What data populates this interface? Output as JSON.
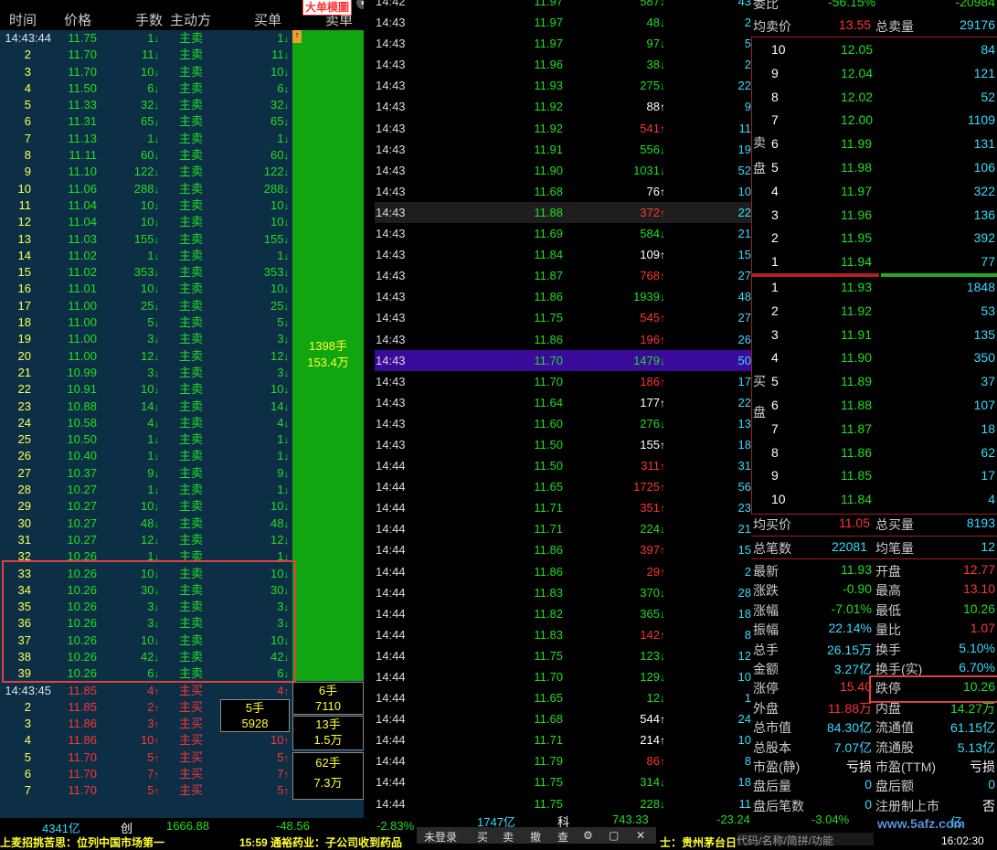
{
  "left": {
    "headers": [
      "时间",
      "价格",
      "手数",
      "主动方",
      "买单",
      "卖单"
    ],
    "badge": "大单模圖",
    "rows": [
      {
        "t": "14:43:44",
        "p": "11.75",
        "v": "1",
        "s": "主卖",
        "b": "1"
      },
      {
        "t": "2",
        "p": "11.70",
        "v": "11",
        "s": "主卖",
        "b": "11"
      },
      {
        "t": "3",
        "p": "11.70",
        "v": "10",
        "s": "主卖",
        "b": "10"
      },
      {
        "t": "4",
        "p": "11.50",
        "v": "6",
        "s": "主卖",
        "b": "6"
      },
      {
        "t": "5",
        "p": "11.33",
        "v": "32",
        "s": "主卖",
        "b": "32"
      },
      {
        "t": "6",
        "p": "11.31",
        "v": "65",
        "s": "主卖",
        "b": "65"
      },
      {
        "t": "7",
        "p": "11.13",
        "v": "1",
        "s": "主卖",
        "b": "1"
      },
      {
        "t": "8",
        "p": "11.11",
        "v": "60",
        "s": "主卖",
        "b": "60"
      },
      {
        "t": "9",
        "p": "11.10",
        "v": "122",
        "s": "主卖",
        "b": "122"
      },
      {
        "t": "10",
        "p": "11.06",
        "v": "288",
        "s": "主卖",
        "b": "288"
      },
      {
        "t": "11",
        "p": "11.04",
        "v": "10",
        "s": "主卖",
        "b": "10"
      },
      {
        "t": "12",
        "p": "11.04",
        "v": "10",
        "s": "主卖",
        "b": "10"
      },
      {
        "t": "13",
        "p": "11.03",
        "v": "155",
        "s": "主卖",
        "b": "155"
      },
      {
        "t": "14",
        "p": "11.02",
        "v": "1",
        "s": "主卖",
        "b": "1"
      },
      {
        "t": "15",
        "p": "11.02",
        "v": "353",
        "s": "主卖",
        "b": "353"
      },
      {
        "t": "16",
        "p": "11.01",
        "v": "10",
        "s": "主卖",
        "b": "10"
      },
      {
        "t": "17",
        "p": "11.00",
        "v": "25",
        "s": "主卖",
        "b": "25"
      },
      {
        "t": "18",
        "p": "11.00",
        "v": "5",
        "s": "主卖",
        "b": "5"
      },
      {
        "t": "19",
        "p": "11.00",
        "v": "3",
        "s": "主卖",
        "b": "3"
      },
      {
        "t": "20",
        "p": "11.00",
        "v": "12",
        "s": "主卖",
        "b": "12"
      },
      {
        "t": "21",
        "p": "10.99",
        "v": "3",
        "s": "主卖",
        "b": "3"
      },
      {
        "t": "22",
        "p": "10.91",
        "v": "10",
        "s": "主卖",
        "b": "10"
      },
      {
        "t": "23",
        "p": "10.88",
        "v": "14",
        "s": "主卖",
        "b": "14"
      },
      {
        "t": "24",
        "p": "10.58",
        "v": "4",
        "s": "主卖",
        "b": "4"
      },
      {
        "t": "25",
        "p": "10.50",
        "v": "1",
        "s": "主卖",
        "b": "1"
      },
      {
        "t": "26",
        "p": "10.40",
        "v": "1",
        "s": "主卖",
        "b": "1"
      },
      {
        "t": "27",
        "p": "10.37",
        "v": "9",
        "s": "主卖",
        "b": "9"
      },
      {
        "t": "28",
        "p": "10.27",
        "v": "1",
        "s": "主卖",
        "b": "1"
      },
      {
        "t": "29",
        "p": "10.27",
        "v": "10",
        "s": "主卖",
        "b": "10"
      },
      {
        "t": "30",
        "p": "10.27",
        "v": "48",
        "s": "主卖",
        "b": "48"
      },
      {
        "t": "31",
        "p": "10.27",
        "v": "12",
        "s": "主卖",
        "b": "12"
      },
      {
        "t": "32",
        "p": "10.26",
        "v": "1",
        "s": "主卖",
        "b": "1"
      },
      {
        "t": "33",
        "p": "10.26",
        "v": "10",
        "s": "主卖",
        "b": "10"
      },
      {
        "t": "34",
        "p": "10.26",
        "v": "30",
        "s": "主卖",
        "b": "30"
      },
      {
        "t": "35",
        "p": "10.26",
        "v": "3",
        "s": "主卖",
        "b": "3"
      },
      {
        "t": "36",
        "p": "10.26",
        "v": "3",
        "s": "主卖",
        "b": "3"
      },
      {
        "t": "37",
        "p": "10.26",
        "v": "10",
        "s": "主卖",
        "b": "10"
      },
      {
        "t": "38",
        "p": "10.26",
        "v": "42",
        "s": "主卖",
        "b": "42"
      },
      {
        "t": "39",
        "p": "10.26",
        "v": "6",
        "s": "主卖",
        "b": "6"
      },
      {
        "t": "14:43:45",
        "p": "11.85",
        "v": "4",
        "s": "主买",
        "b": "4"
      },
      {
        "t": "2",
        "p": "11.85",
        "v": "2",
        "s": "主买",
        "b": "2"
      },
      {
        "t": "3",
        "p": "11.86",
        "v": "3",
        "s": "主买",
        "b": "3"
      },
      {
        "t": "4",
        "p": "11.86",
        "v": "10",
        "s": "主买",
        "b": "10"
      },
      {
        "t": "5",
        "p": "11.70",
        "v": "5",
        "s": "主买",
        "b": "5"
      },
      {
        "t": "6",
        "p": "11.70",
        "v": "7",
        "s": "主买",
        "b": "7"
      },
      {
        "t": "7",
        "p": "11.70",
        "v": "5",
        "s": "主买",
        "b": "5"
      }
    ],
    "big_buy": [
      "1398手",
      "153.4万"
    ],
    "order_boxes": [
      {
        "a": "6手",
        "b": "7110"
      },
      {
        "a": "5手",
        "b": "5928"
      },
      {
        "a": "13手",
        "b": "1.5万"
      },
      {
        "a": "62手",
        "b": "7.3万"
      }
    ]
  },
  "mid": {
    "rows": [
      {
        "t": "14:42",
        "p": "11.97",
        "v": "587",
        "d": "down",
        "n": "43"
      },
      {
        "t": "14:43",
        "p": "11.97",
        "v": "48",
        "d": "down",
        "n": "2"
      },
      {
        "t": "14:43",
        "p": "11.97",
        "v": "97",
        "d": "down",
        "n": "5"
      },
      {
        "t": "14:43",
        "p": "11.96",
        "v": "38",
        "d": "down",
        "n": "2"
      },
      {
        "t": "14:43",
        "p": "11.93",
        "v": "275",
        "d": "down",
        "n": "22"
      },
      {
        "t": "14:43",
        "p": "11.92",
        "v": "88",
        "d": "up-w",
        "n": "9"
      },
      {
        "t": "14:43",
        "p": "11.92",
        "v": "541",
        "d": "up",
        "n": "11"
      },
      {
        "t": "14:43",
        "p": "11.91",
        "v": "556",
        "d": "down",
        "n": "19"
      },
      {
        "t": "14:43",
        "p": "11.90",
        "v": "1031",
        "d": "down",
        "n": "52"
      },
      {
        "t": "14:43",
        "p": "11.68",
        "v": "76",
        "d": "up-w",
        "n": "10"
      },
      {
        "t": "14:43",
        "p": "11.88",
        "v": "372",
        "d": "up",
        "n": "22"
      },
      {
        "t": "14:43",
        "p": "11.69",
        "v": "584",
        "d": "down",
        "n": "21"
      },
      {
        "t": "14:43",
        "p": "11.84",
        "v": "109",
        "d": "up-w",
        "n": "15"
      },
      {
        "t": "14:43",
        "p": "11.87",
        "v": "768",
        "d": "up",
        "n": "27"
      },
      {
        "t": "14:43",
        "p": "11.86",
        "v": "1939",
        "d": "down",
        "n": "48"
      },
      {
        "t": "14:43",
        "p": "11.75",
        "v": "545",
        "d": "up",
        "n": "27"
      },
      {
        "t": "14:43",
        "p": "11.86",
        "v": "196",
        "d": "up",
        "n": "26"
      },
      {
        "t": "14:43",
        "p": "11.70",
        "v": "1479",
        "d": "down",
        "n": "50"
      },
      {
        "t": "14:43",
        "p": "11.70",
        "v": "186",
        "d": "up",
        "n": "17"
      },
      {
        "t": "14:43",
        "p": "11.64",
        "v": "177",
        "d": "up-w",
        "n": "22"
      },
      {
        "t": "14:43",
        "p": "11.60",
        "v": "276",
        "d": "down",
        "n": "13"
      },
      {
        "t": "14:43",
        "p": "11.50",
        "v": "155",
        "d": "up-w",
        "n": "18"
      },
      {
        "t": "14:44",
        "p": "11.50",
        "v": "311",
        "d": "up",
        "n": "31"
      },
      {
        "t": "14:44",
        "p": "11.65",
        "v": "1725",
        "d": "up",
        "n": "56"
      },
      {
        "t": "14:44",
        "p": "11.71",
        "v": "351",
        "d": "up",
        "n": "23"
      },
      {
        "t": "14:44",
        "p": "11.71",
        "v": "224",
        "d": "down",
        "n": "21"
      },
      {
        "t": "14:44",
        "p": "11.86",
        "v": "397",
        "d": "up",
        "n": "15"
      },
      {
        "t": "14:44",
        "p": "11.86",
        "v": "29",
        "d": "up",
        "n": "2"
      },
      {
        "t": "14:44",
        "p": "11.83",
        "v": "370",
        "d": "down",
        "n": "28"
      },
      {
        "t": "14:44",
        "p": "11.82",
        "v": "365",
        "d": "down",
        "n": "18"
      },
      {
        "t": "14:44",
        "p": "11.83",
        "v": "142",
        "d": "up",
        "n": "8"
      },
      {
        "t": "14:44",
        "p": "11.75",
        "v": "123",
        "d": "down",
        "n": "12"
      },
      {
        "t": "14:44",
        "p": "11.70",
        "v": "129",
        "d": "down",
        "n": "10"
      },
      {
        "t": "14:44",
        "p": "11.65",
        "v": "12",
        "d": "down",
        "n": "1"
      },
      {
        "t": "14:44",
        "p": "11.68",
        "v": "544",
        "d": "up-w",
        "n": "24"
      },
      {
        "t": "14:44",
        "p": "11.71",
        "v": "214",
        "d": "up-w",
        "n": "10"
      },
      {
        "t": "14:44",
        "p": "11.79",
        "v": "86",
        "d": "up",
        "n": "8"
      },
      {
        "t": "14:44",
        "p": "11.75",
        "v": "314",
        "d": "down",
        "n": "18"
      },
      {
        "t": "14:44",
        "p": "11.75",
        "v": "228",
        "d": "down",
        "n": "11"
      }
    ]
  },
  "right": {
    "top_ratio_label": "委比",
    "top_ratio_value": "-56.15%",
    "top_diff": "-20984",
    "avg_sell_label": "均卖价",
    "avg_sell_value": "13.55",
    "total_sell_label": "总卖量",
    "total_sell_value": "29176",
    "sell_side_label": "卖盘",
    "buy_side_label": "买盘",
    "sells": [
      {
        "n": "10",
        "p": "12.05",
        "v": "84"
      },
      {
        "n": "9",
        "p": "12.04",
        "v": "121"
      },
      {
        "n": "8",
        "p": "12.02",
        "v": "52"
      },
      {
        "n": "7",
        "p": "12.00",
        "v": "1109"
      },
      {
        "n": "6",
        "p": "11.99",
        "v": "131"
      },
      {
        "n": "5",
        "p": "11.98",
        "v": "106"
      },
      {
        "n": "4",
        "p": "11.97",
        "v": "322"
      },
      {
        "n": "3",
        "p": "11.96",
        "v": "136"
      },
      {
        "n": "2",
        "p": "11.95",
        "v": "392"
      },
      {
        "n": "1",
        "p": "11.94",
        "v": "77"
      }
    ],
    "buys": [
      {
        "n": "1",
        "p": "11.93",
        "v": "1848"
      },
      {
        "n": "2",
        "p": "11.92",
        "v": "53"
      },
      {
        "n": "3",
        "p": "11.91",
        "v": "135"
      },
      {
        "n": "4",
        "p": "11.90",
        "v": "350"
      },
      {
        "n": "5",
        "p": "11.89",
        "v": "37"
      },
      {
        "n": "6",
        "p": "11.88",
        "v": "107"
      },
      {
        "n": "7",
        "p": "11.87",
        "v": "18"
      },
      {
        "n": "8",
        "p": "11.86",
        "v": "62"
      },
      {
        "n": "9",
        "p": "11.85",
        "v": "17"
      },
      {
        "n": "10",
        "p": "11.84",
        "v": "4"
      }
    ],
    "avg_buy_label": "均买价",
    "avg_buy_value": "11.05",
    "total_buy_label": "总买量",
    "total_buy_value": "8193",
    "trades_label": "总笔数",
    "trades_value": "22081",
    "avg_trade_label": "均笔量",
    "avg_trade_value": "12",
    "stats": [
      {
        "l1": "最新",
        "v1": "11.93",
        "c1": "g",
        "l2": "开盘",
        "v2": "12.77",
        "c2": "r"
      },
      {
        "l1": "涨跌",
        "v1": "-0.90",
        "c1": "g",
        "l2": "最高",
        "v2": "13.10",
        "c2": "r"
      },
      {
        "l1": "涨幅",
        "v1": "-7.01%",
        "c1": "g",
        "l2": "最低",
        "v2": "10.26",
        "c2": "g"
      },
      {
        "l1": "振幅",
        "v1": "22.14%",
        "c1": "cy",
        "l2": "量比",
        "v2": "1.07",
        "c2": "r"
      },
      {
        "l1": "总手",
        "v1": "26.15万",
        "c1": "cy",
        "l2": "换手",
        "v2": "5.10%",
        "c2": "cy"
      },
      {
        "l1": "金额",
        "v1": "3.27亿",
        "c1": "cy",
        "l2": "换手(实)",
        "v2": "6.70%",
        "c2": "cy"
      },
      {
        "l1": "涨停",
        "v1": "15.40",
        "c1": "r",
        "l2": "跌停",
        "v2": "10.26",
        "c2": "g"
      },
      {
        "l1": "外盘",
        "v1": "11.88万",
        "c1": "r",
        "l2": "内盘",
        "v2": "14.27万",
        "c2": "g"
      },
      {
        "l1": "总市值",
        "v1": "84.30亿",
        "c1": "cy",
        "l2": "流通值",
        "v2": "61.15亿",
        "c2": "cy"
      },
      {
        "l1": "总股本",
        "v1": "7.07亿",
        "c1": "cy",
        "l2": "流通股",
        "v2": "5.13亿",
        "c2": "cy"
      },
      {
        "l1": "市盈(静)",
        "v1": "亏损",
        "c1": "w",
        "l2": "市盈(TTM)",
        "v2": "亏损",
        "c2": "w"
      },
      {
        "l1": "盘后量",
        "v1": "0",
        "c1": "cy",
        "l2": "盘后额",
        "v2": "0",
        "c2": "cy"
      },
      {
        "l1": "盘后笔数",
        "v1": "0",
        "c1": "cy",
        "l2": "注册制上市",
        "v2": "否",
        "c2": "w"
      }
    ]
  },
  "bottom": {
    "items": [
      "4341亿",
      "创",
      "1666.88",
      "-48.56",
      "-2.83%",
      "1747亿",
      "科",
      "743.33",
      "-23.24",
      "-3.04%",
      "亿"
    ],
    "ticker": "上麦招挑苦思：位列中国市场第一",
    "ticker2": "15:59 通裕药业：子公司收到药品",
    "toolbar": [
      "未登录",
      "买",
      "卖",
      "撤",
      "查",
      "⚙",
      "▢",
      "✕"
    ],
    "ticker3": "士：贵州茅台日",
    "search_hint": "代码/名称/简拼/功能",
    "time": "16:02:30",
    "watermark": "www.5afz.com"
  }
}
